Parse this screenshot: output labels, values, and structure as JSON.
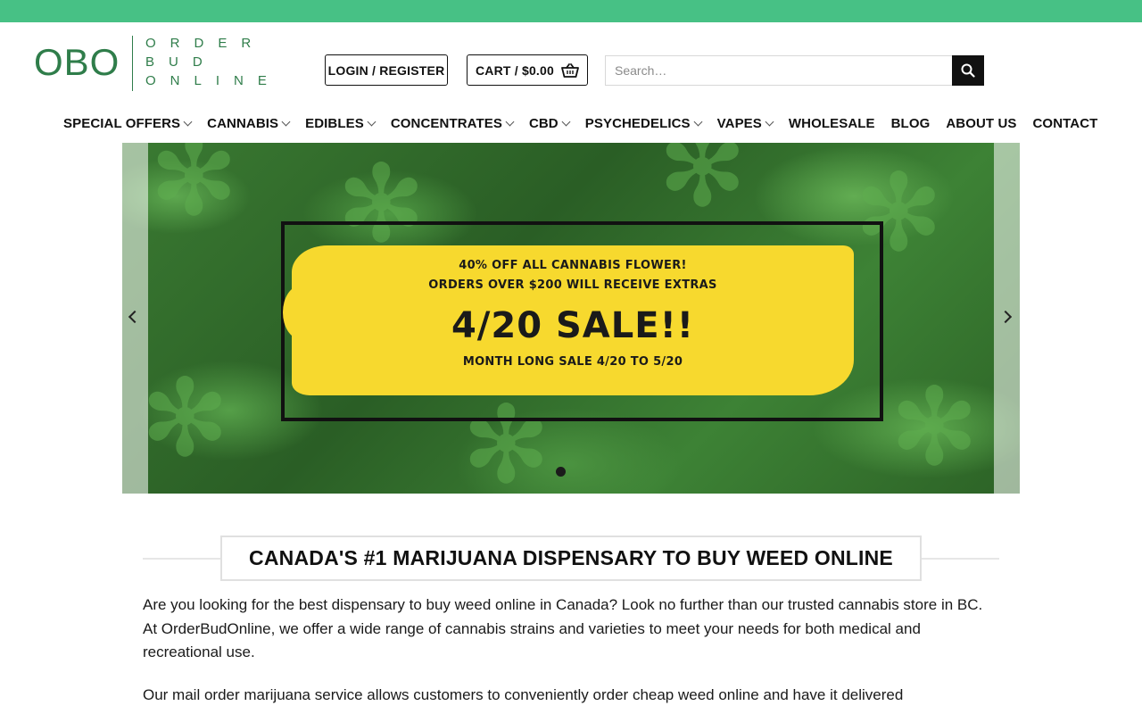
{
  "brand": {
    "mark": "OBO",
    "lines": [
      "ORDER",
      "BUD",
      "ONLINE"
    ],
    "color": "#2f7d4a"
  },
  "topbar": {
    "color": "#47c185"
  },
  "header": {
    "login_label": "LOGIN / REGISTER",
    "cart_label": "CART / $0.00",
    "search_placeholder": "Search…"
  },
  "nav": {
    "items": [
      {
        "label": "SPECIAL OFFERS",
        "has_dropdown": true
      },
      {
        "label": "CANNABIS",
        "has_dropdown": true
      },
      {
        "label": "EDIBLES",
        "has_dropdown": true
      },
      {
        "label": "CONCENTRATES",
        "has_dropdown": true
      },
      {
        "label": "CBD",
        "has_dropdown": true
      },
      {
        "label": "PSYCHEDELICS",
        "has_dropdown": true
      },
      {
        "label": "VAPES",
        "has_dropdown": true
      },
      {
        "label": "WHOLESALE",
        "has_dropdown": false
      },
      {
        "label": "BLOG",
        "has_dropdown": false
      },
      {
        "label": "ABOUT US",
        "has_dropdown": false
      },
      {
        "label": "CONTACT",
        "has_dropdown": false
      }
    ]
  },
  "hero": {
    "line1": "40% OFF ALL CANNABIS FLOWER!",
    "line2": "ORDERS OVER $200 WILL RECEIVE EXTRAS",
    "title": "4/20 SALE!!",
    "subtitle": "MONTH LONG SALE 4/20 TO 5/20",
    "accent_color": "#f7d92e",
    "slide_count": 1,
    "active_slide": 1
  },
  "content": {
    "heading": "CANADA'S #1 MARIJUANA DISPENSARY TO BUY WEED ONLINE",
    "paragraph1": "Are you looking for the best dispensary to buy weed online in Canada? Look no further than our trusted cannabis store in BC. At OrderBudOnline, we offer a wide range of cannabis strains and varieties to meet your needs for both medical and recreational use.",
    "paragraph2": "Our mail order marijuana service allows customers to conveniently order cheap weed online and have it delivered"
  }
}
